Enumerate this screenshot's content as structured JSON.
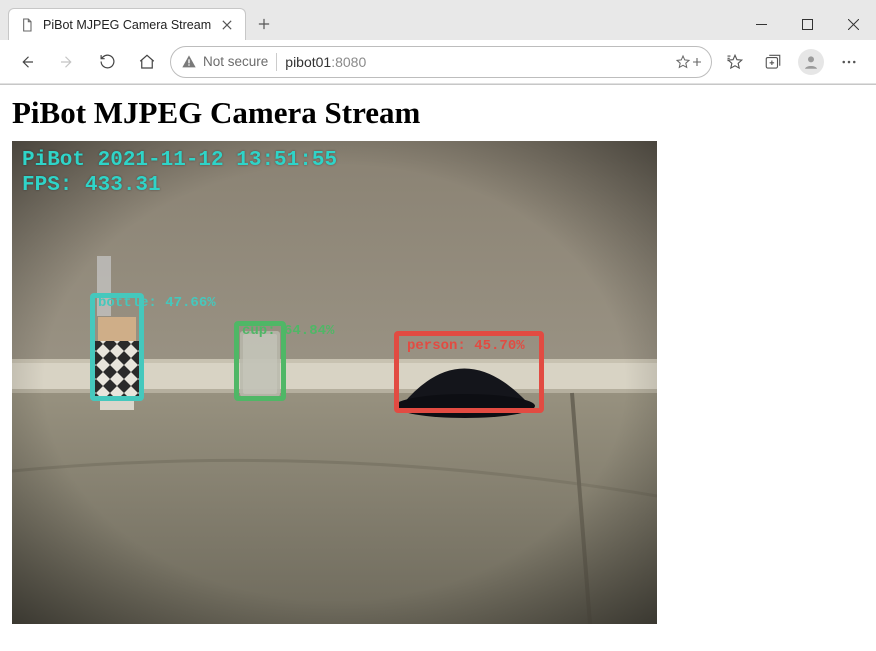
{
  "tab": {
    "title": "PiBot MJPEG Camera Stream"
  },
  "toolbar": {
    "security_label": "Not secure",
    "url_host": "pibot01",
    "url_port": ":8080"
  },
  "page": {
    "heading": "PiBot MJPEG Camera Stream"
  },
  "stream": {
    "overlay_line1": "PiBot 2021-11-12 13:51:55",
    "overlay_line2": "FPS: 433.31",
    "detections": {
      "bottle": {
        "label": "bottle: 47.66%"
      },
      "cup": {
        "label": "cup: 64.84%"
      },
      "person": {
        "label": "person: 45.70%"
      }
    }
  }
}
